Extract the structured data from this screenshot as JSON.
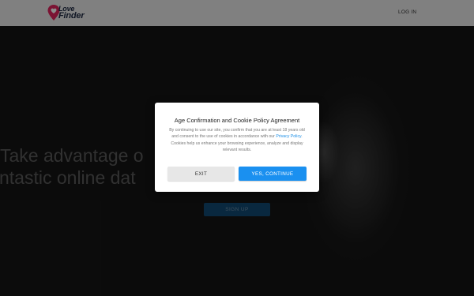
{
  "header": {
    "logo_top": "Love",
    "logo_bottom": "Finder",
    "login_label": "LOG IN"
  },
  "hero": {
    "heading_line1": "Take advantage o",
    "heading_line2": "ntastic online dat",
    "signup_label": "SIGN UP"
  },
  "modal": {
    "title": "Age Confirmation and Cookie Policy Agreement",
    "body_before": "By continuing to use our site, you confirm that you are at least 18 years old and consent to the use of cookies in accordance with our ",
    "privacy_link": "Privacy Policy",
    "body_after": ". Cookies help us enhance your browsing experience, analyze and display relevant results.",
    "exit_label": "EXIT",
    "continue_label": "YES, CONTINUE"
  },
  "colors": {
    "accent_blue": "#1a90f0",
    "logo_pin": "#e0245e",
    "logo_text": "#1f2a44"
  },
  "icons": {
    "logo_pin": "map-pin-heart-icon"
  }
}
